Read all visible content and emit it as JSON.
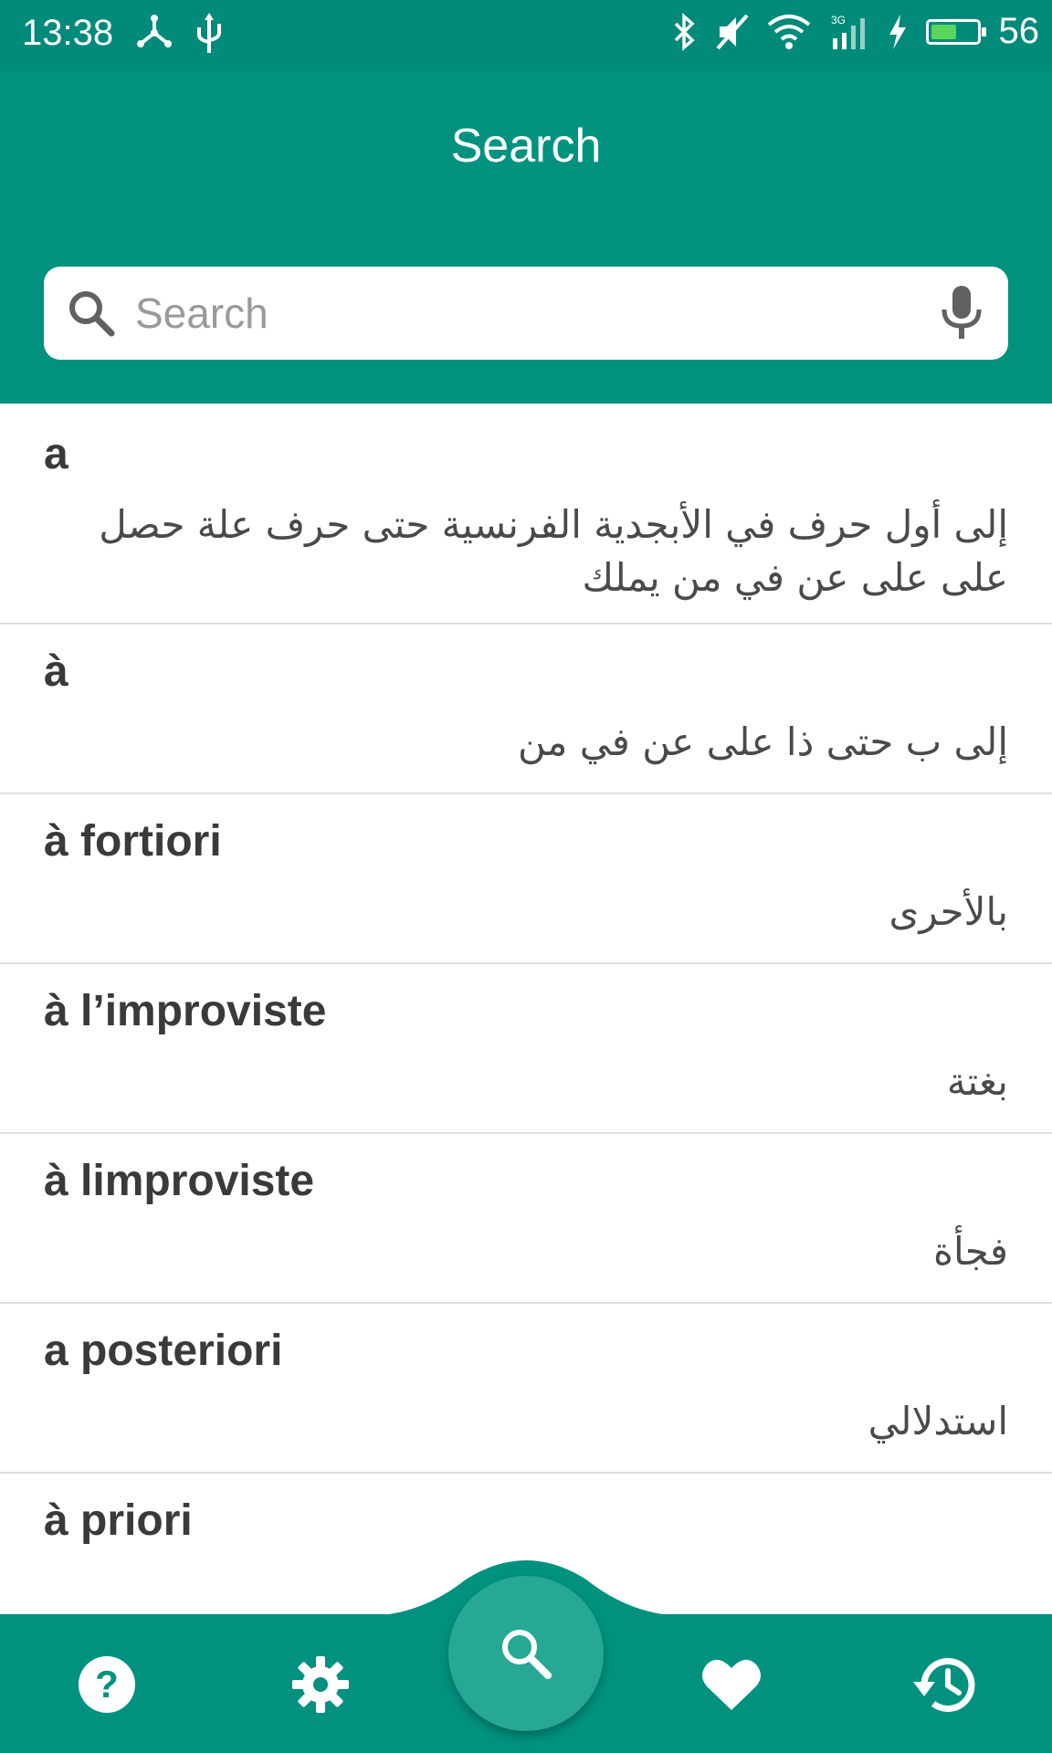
{
  "status_bar": {
    "time": "13:38",
    "battery_percent": "56",
    "battery_level": 0.56,
    "icons": [
      "usb-debug-icon",
      "usb-icon",
      "bluetooth-icon",
      "mute-icon",
      "wifi-icon",
      "signal-3g-icon",
      "charging-icon",
      "battery-icon"
    ]
  },
  "header": {
    "title": "Search"
  },
  "search": {
    "placeholder": "Search",
    "value": ""
  },
  "entries": [
    {
      "term": "a",
      "translation": "إلى أول حرف في الأبجدية الفرنسية حتى حرف علة حصل على على عن في من يملك"
    },
    {
      "term": "à",
      "translation": "إلى ب حتى ذا على عن في من"
    },
    {
      "term": "à fortiori",
      "translation": "بالأحرى"
    },
    {
      "term": "à l’improviste",
      "translation": "بغتة"
    },
    {
      "term": "à limproviste",
      "translation": "فجأة"
    },
    {
      "term": "a posteriori",
      "translation": "استدلالي"
    },
    {
      "term": "à priori",
      "translation": ""
    }
  ],
  "bottom_nav": {
    "items": [
      "help-icon",
      "settings-icon",
      "search-icon",
      "favorites-icon",
      "history-icon"
    ],
    "active": "search-icon"
  },
  "colors": {
    "status_bar": "#008a7a",
    "primary": "#00927f",
    "fab": "#26a895"
  }
}
